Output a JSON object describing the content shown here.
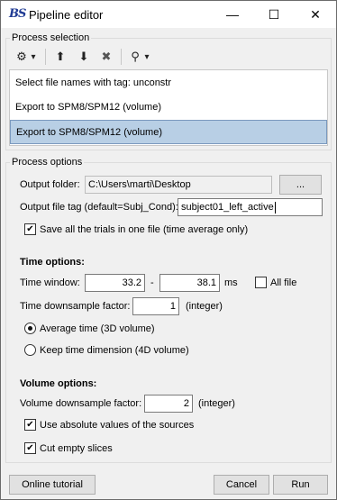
{
  "window": {
    "title": "Pipeline editor",
    "app_icon": "BS"
  },
  "process_selection": {
    "title": "Process selection",
    "items": [
      {
        "label": "Select file names with tag: unconstr",
        "selected": false
      },
      {
        "label": "Export to SPM8/SPM12 (volume)",
        "selected": false
      },
      {
        "label": "Export to SPM8/SPM12 (volume)",
        "selected": true
      }
    ]
  },
  "process_options": {
    "title": "Process options",
    "output_folder_label": "Output folder:",
    "output_folder_value": "C:\\Users\\marti\\Desktop",
    "browse_label": "...",
    "output_tag_label": "Output file tag (default=Subj_Cond):",
    "output_tag_value": "subject01_left_active",
    "save_trials_label": "Save all the trials in one file (time average only)",
    "save_trials_checked": true,
    "time_options_title": "Time options:",
    "time_window_label": "Time window:",
    "time_start": "33.2",
    "time_dash": "-",
    "time_end": "38.1",
    "time_unit": "ms",
    "all_file_label": "All file",
    "all_file_checked": false,
    "time_downsample_label": "Time downsample factor:",
    "time_downsample_value": "1",
    "time_downsample_unit": "(integer)",
    "avg_time_label": "Average time (3D volume)",
    "avg_time_selected": true,
    "keep_time_label": "Keep time dimension (4D volume)",
    "keep_time_selected": false,
    "volume_options_title": "Volume options:",
    "vol_downsample_label": "Volume downsample factor:",
    "vol_downsample_value": "2",
    "vol_downsample_unit": "(integer)",
    "abs_values_label": "Use absolute values of the sources",
    "abs_values_checked": true,
    "cut_empty_label": "Cut empty slices",
    "cut_empty_checked": true
  },
  "footer": {
    "tutorial_label": "Online tutorial",
    "cancel_label": "Cancel",
    "run_label": "Run"
  },
  "check_mark": "✔",
  "icons": {
    "gear": "⚙",
    "dropdown": "▾",
    "up": "⬆",
    "down": "⬇",
    "delete": "✖",
    "tree": "⚲",
    "minimize": "—",
    "maximize": "☐",
    "close": "✕"
  }
}
